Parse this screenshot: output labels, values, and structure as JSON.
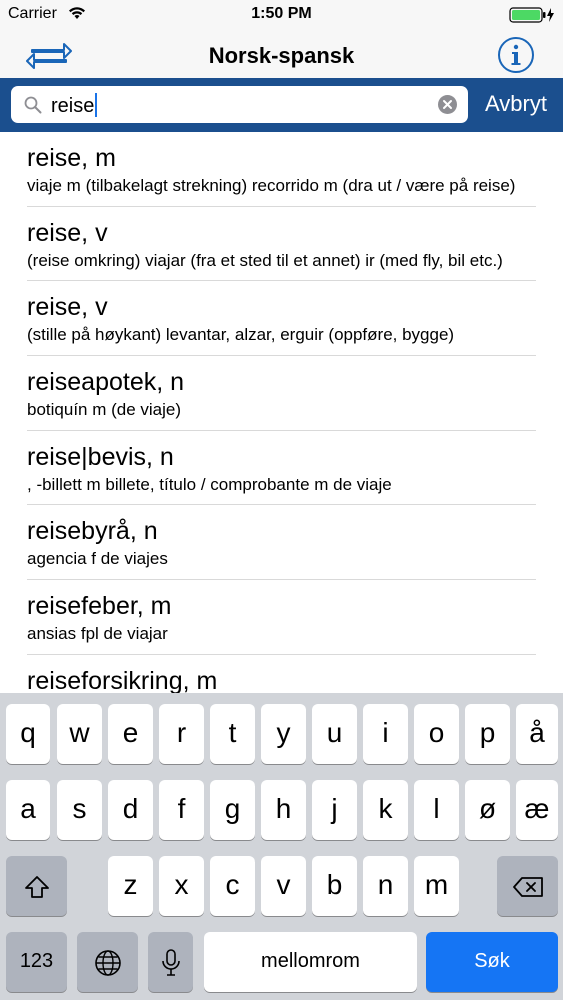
{
  "status_bar": {
    "carrier": "Carrier",
    "time": "1:50 PM"
  },
  "nav": {
    "title": "Norsk-spansk",
    "left_icon": "swap-arrows-icon",
    "right_icon": "info-icon",
    "accent": "#1a66b8"
  },
  "search": {
    "value": "reise",
    "cancel_label": "Avbryt",
    "bar_color": "#1b4f8e"
  },
  "results": [
    {
      "term": "reise, m",
      "definition": "viaje m (tilbakelagt strekning) recorrido m (dra ut / være på reise)"
    },
    {
      "term": "reise, v",
      "definition": "(reise omkring) viajar (fra et sted til et annet) ir (med fly, bil etc.)"
    },
    {
      "term": "reise, v",
      "definition": "(stille på høykant) levantar, alzar, erguir (oppføre, bygge)"
    },
    {
      "term": "reiseapotek, n",
      "definition": "botiquín m (de viaje)"
    },
    {
      "term": "reise|bevis, n",
      "definition": ", -billett m billete, título / comprobante m de viaje"
    },
    {
      "term": "reisebyrå, n",
      "definition": "agencia f de viajes"
    },
    {
      "term": "reisefeber, m",
      "definition": "ansias fpl de viajar"
    },
    {
      "term": "reiseforsikring, m",
      "definition": ""
    }
  ],
  "keyboard": {
    "row1": [
      "q",
      "w",
      "e",
      "r",
      "t",
      "y",
      "u",
      "i",
      "o",
      "p",
      "å"
    ],
    "row2": [
      "a",
      "s",
      "d",
      "f",
      "g",
      "h",
      "j",
      "k",
      "l",
      "ø",
      "æ"
    ],
    "row3": [
      "z",
      "x",
      "c",
      "v",
      "b",
      "n",
      "m"
    ],
    "numbers_label": "123",
    "space_label": "mellomrom",
    "return_label": "Søk",
    "return_color": "#1575f4"
  }
}
